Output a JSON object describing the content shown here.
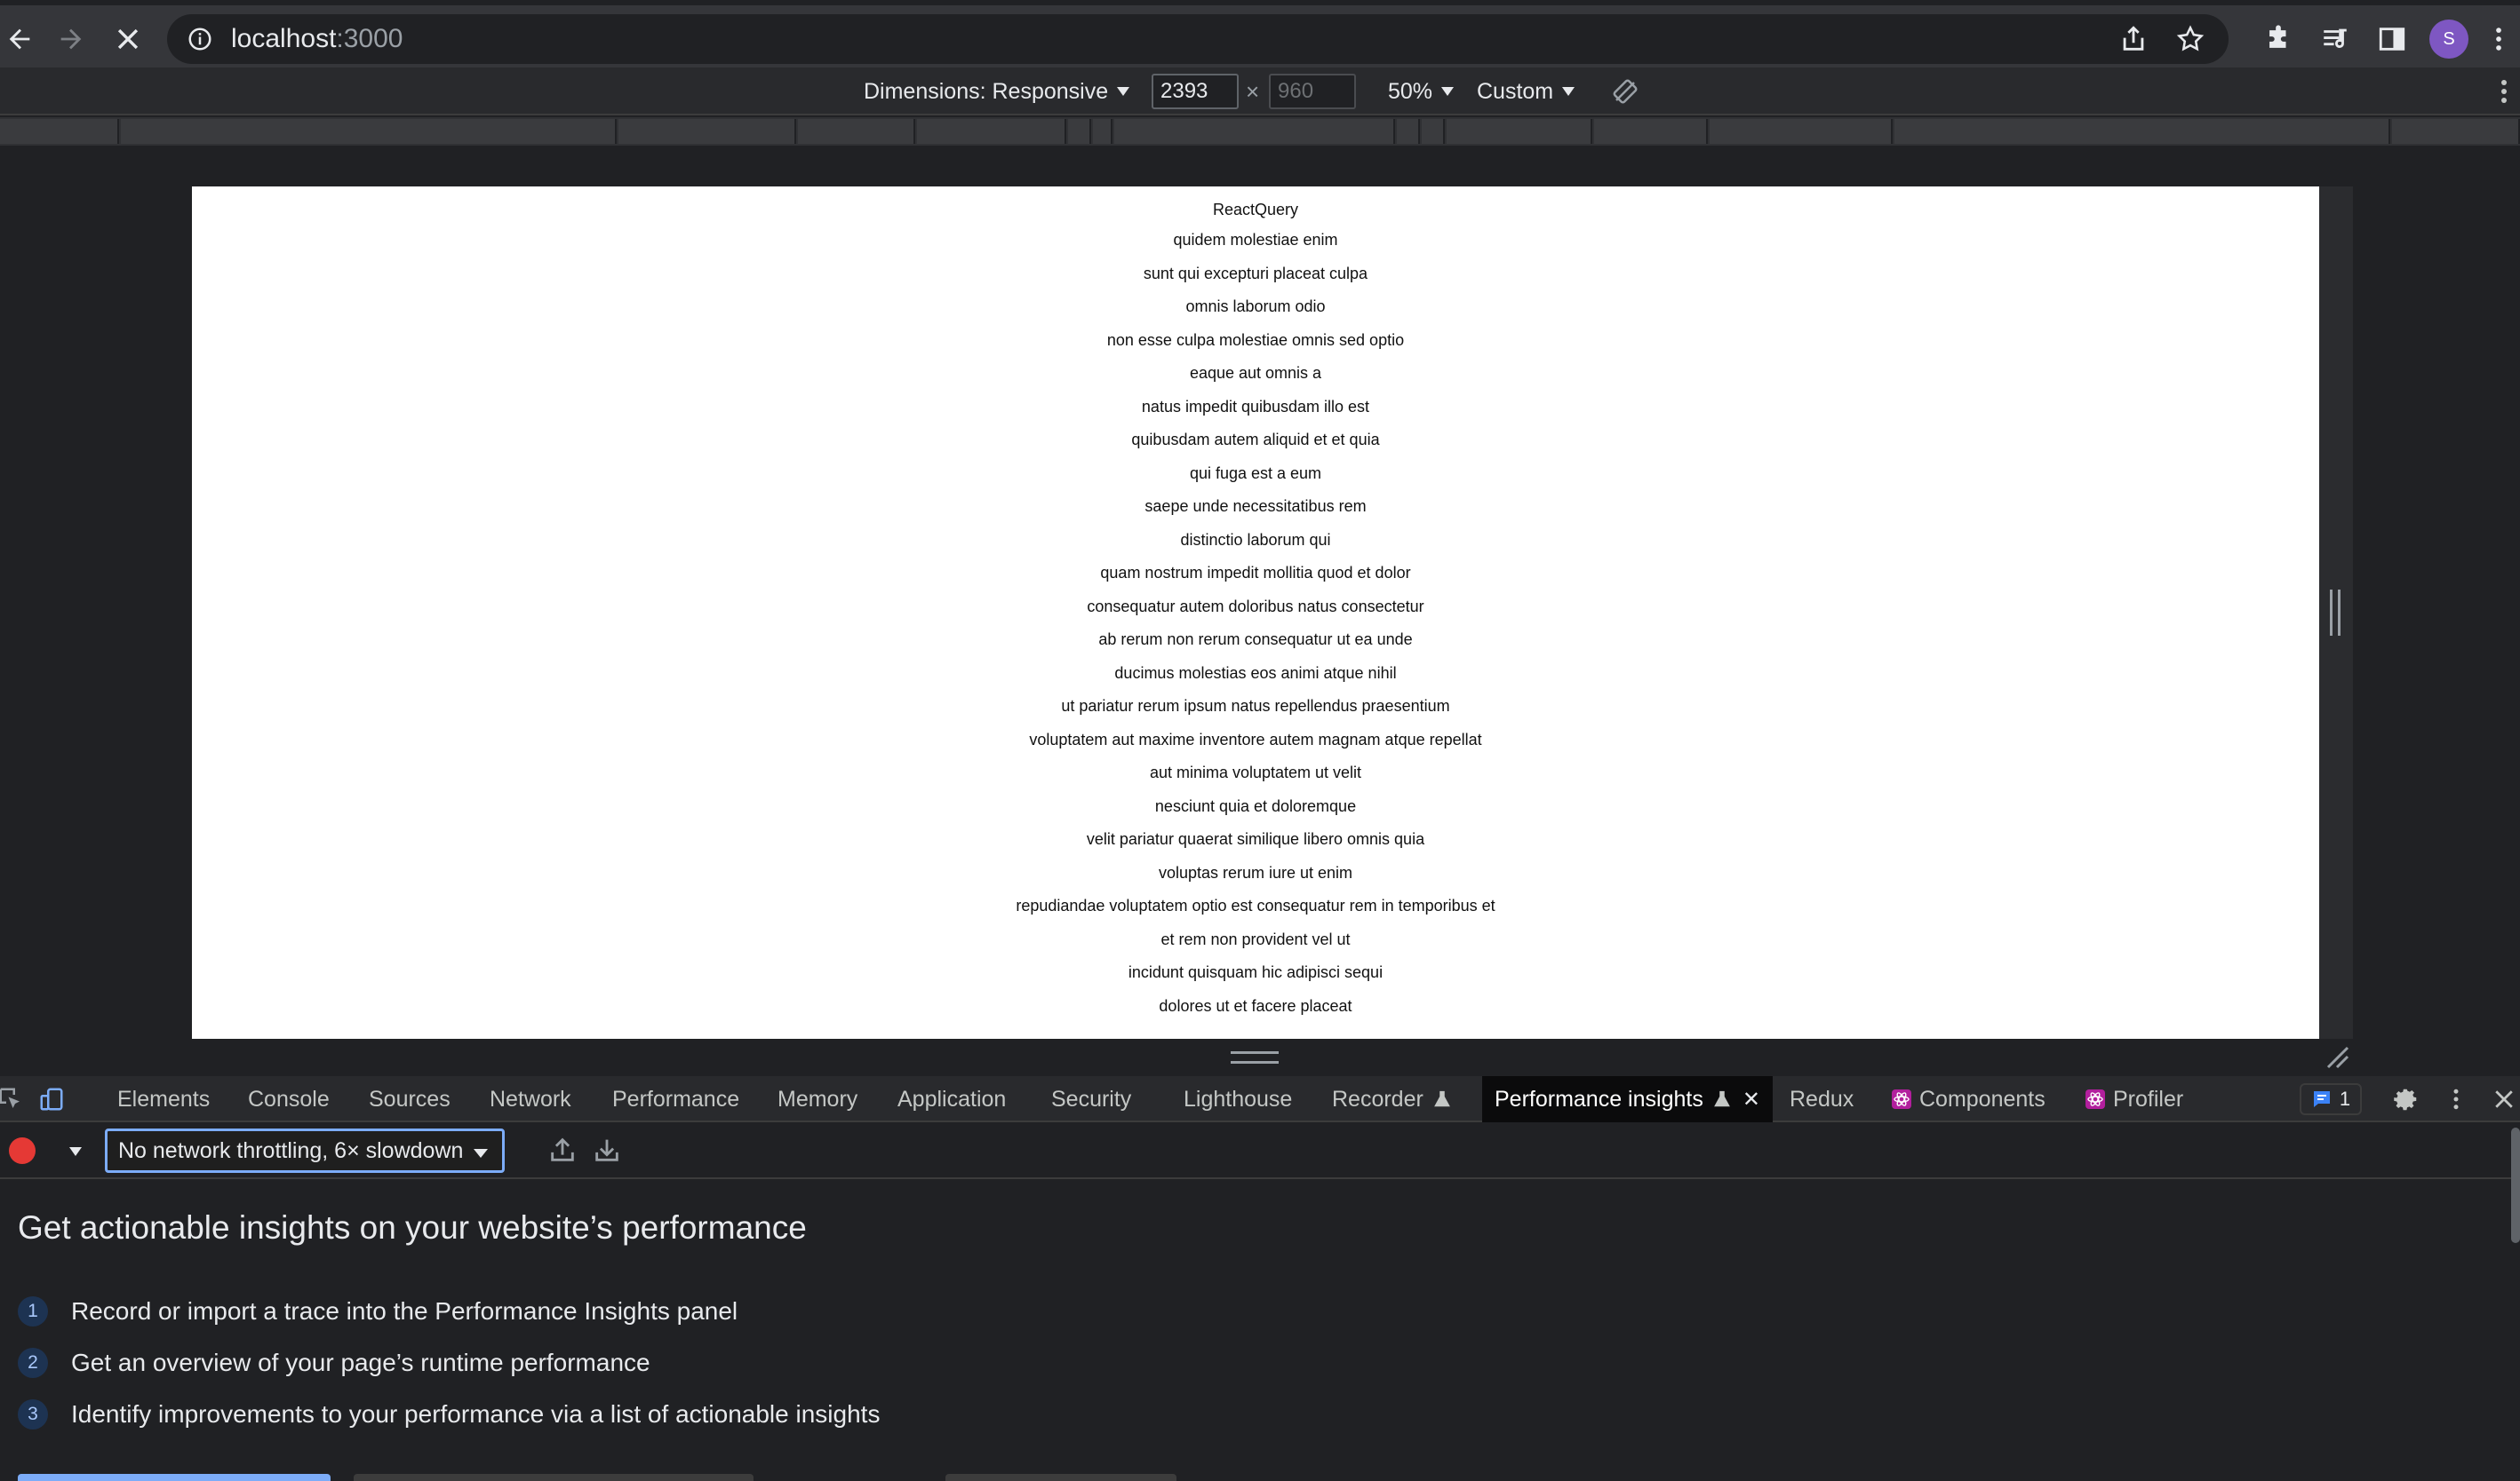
{
  "browser": {
    "url_host": "localhost",
    "url_port": ":3000",
    "profile_initial": "S"
  },
  "device_toolbar": {
    "dimensions_label": "Dimensions: Responsive",
    "width_value": "2393",
    "times": "×",
    "height_placeholder": "960",
    "zoom": "50%",
    "throttle_preset": "Custom"
  },
  "page": {
    "title": "ReactQuery",
    "posts": [
      "quidem molestiae enim",
      "sunt qui excepturi placeat culpa",
      "omnis laborum odio",
      "non esse culpa molestiae omnis sed optio",
      "eaque aut omnis a",
      "natus impedit quibusdam illo est",
      "quibusdam autem aliquid et et quia",
      "qui fuga est a eum",
      "saepe unde necessitatibus rem",
      "distinctio laborum qui",
      "quam nostrum impedit mollitia quod et dolor",
      "consequatur autem doloribus natus consectetur",
      "ab rerum non rerum consequatur ut ea unde",
      "ducimus molestias eos animi atque nihil",
      "ut pariatur rerum ipsum natus repellendus praesentium",
      "voluptatem aut maxime inventore autem magnam atque repellat",
      "aut minima voluptatem ut velit",
      "nesciunt quia et doloremque",
      "velit pariatur quaerat similique libero omnis quia",
      "voluptas rerum iure ut enim",
      "repudiandae voluptatem optio est consequatur rem in temporibus et",
      "et rem non provident vel ut",
      "incidunt quisquam hic adipisci sequi",
      "dolores ut et facere placeat"
    ]
  },
  "devtools": {
    "tabs": [
      "Elements",
      "Console",
      "Sources",
      "Network",
      "Performance",
      "Memory",
      "Application",
      "Security",
      "Lighthouse",
      "Recorder",
      "Performance insights",
      "Redux",
      "Components",
      "Profiler"
    ],
    "active_tab": "Performance insights",
    "issues_count": "1",
    "throttling_value": "No network throttling, 6× slowdown",
    "heading": "Get actionable insights on your website’s performance",
    "steps": [
      {
        "n": "1",
        "text": "Record or import a trace into the Performance Insights panel"
      },
      {
        "n": "2",
        "text": "Get an overview of your page’s runtime performance"
      },
      {
        "n": "3",
        "text": "Identify improvements to your performance via a list of actionable insights"
      }
    ]
  },
  "colors": {
    "record": "#e53935",
    "focus_ring": "#7cacf8",
    "avatar": "#7e57c2"
  }
}
